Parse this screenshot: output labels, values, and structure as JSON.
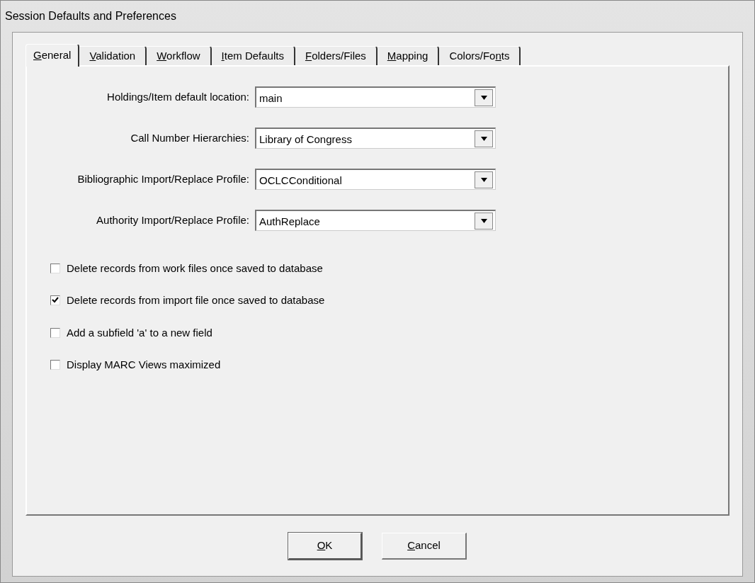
{
  "window": {
    "title": "Session Defaults and Preferences"
  },
  "tabs": [
    {
      "label_parts": [
        {
          "text": "G",
          "underlined": true
        },
        {
          "text": "eneral",
          "underlined": false
        }
      ],
      "selected": true
    },
    {
      "label_parts": [
        {
          "text": "V",
          "underlined": true
        },
        {
          "text": "alidation",
          "underlined": false
        }
      ],
      "selected": false
    },
    {
      "label_parts": [
        {
          "text": "W",
          "underlined": true
        },
        {
          "text": "orkflow",
          "underlined": false
        }
      ],
      "selected": false
    },
    {
      "label_parts": [
        {
          "text": "I",
          "underlined": true
        },
        {
          "text": "tem Defaults",
          "underlined": false
        }
      ],
      "selected": false
    },
    {
      "label_parts": [
        {
          "text": "F",
          "underlined": true
        },
        {
          "text": "olders/Files",
          "underlined": false
        }
      ],
      "selected": false
    },
    {
      "label_parts": [
        {
          "text": "M",
          "underlined": true
        },
        {
          "text": "apping",
          "underlined": false
        }
      ],
      "selected": false
    },
    {
      "label_parts": [
        {
          "text": "Colors/Fo",
          "underlined": false
        },
        {
          "text": "n",
          "underlined": true
        },
        {
          "text": "ts",
          "underlined": false
        }
      ],
      "selected": false
    }
  ],
  "fields": [
    {
      "label": "Holdings/Item default location:",
      "value": "main"
    },
    {
      "label": "Call Number Hierarchies:",
      "value": "Library of Congress"
    },
    {
      "label": "Bibliographic Import/Replace Profile:",
      "value": "OCLCConditional"
    },
    {
      "label": "Authority Import/Replace Profile:",
      "value": "AuthReplace"
    }
  ],
  "checkbox_groups": [
    [
      {
        "label": "Delete records from work files once saved to database",
        "checked": false
      },
      {
        "label": "Delete records from import file once saved to database",
        "checked": true
      }
    ],
    [
      {
        "label": "Add a subfield 'a' to a new field",
        "checked": false
      },
      {
        "label": "Display MARC Views maximized",
        "checked": false
      }
    ]
  ],
  "buttons": [
    {
      "label_parts": [
        {
          "text": "O",
          "underlined": true
        },
        {
          "text": "K",
          "underlined": false
        }
      ]
    },
    {
      "label_parts": [
        {
          "text": "C",
          "underlined": true
        },
        {
          "text": "ancel",
          "underlined": false
        }
      ]
    }
  ]
}
